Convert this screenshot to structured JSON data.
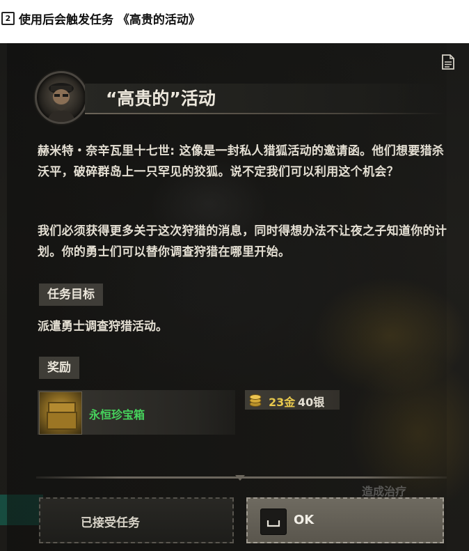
{
  "header": {
    "badge": "2",
    "text": "使用后会触发任务 《高贵的活动》"
  },
  "dialog": {
    "title": "“高贵的”活动",
    "paragraph1": "赫米特・奈辛瓦里十七世: 这像是一封私人猎狐活动的邀请函。他们想要猎杀沃平，破碎群岛上一只罕见的狡狐。说不定我们可以利用这个机会？",
    "paragraph2": "我们必须获得更多关于这次狩猎的消息，同时得想办法不让夜之子知道你的计划。你的勇士们可以替你调查狩猎在哪里开始。",
    "objective_heading": "任务目标",
    "objective_text": "派遣勇士调查狩猎活动。",
    "rewards_heading": "奖励",
    "reward_item": "永恒珍宝箱",
    "money_gold": "23金",
    "money_silver": "40银",
    "background_text": "造成治疗",
    "accept_label": "已接受任务",
    "ok_label": "OK"
  },
  "icons": {
    "document": "document-icon",
    "portrait": "npc-portrait",
    "chest": "treasure-chest-icon",
    "coins": "gold-coins-icon",
    "key": "spacebar-key-icon"
  },
  "colors": {
    "reward_item_name": "#46d35c",
    "gold": "#e9c94d",
    "text": "#e4dfd3"
  }
}
